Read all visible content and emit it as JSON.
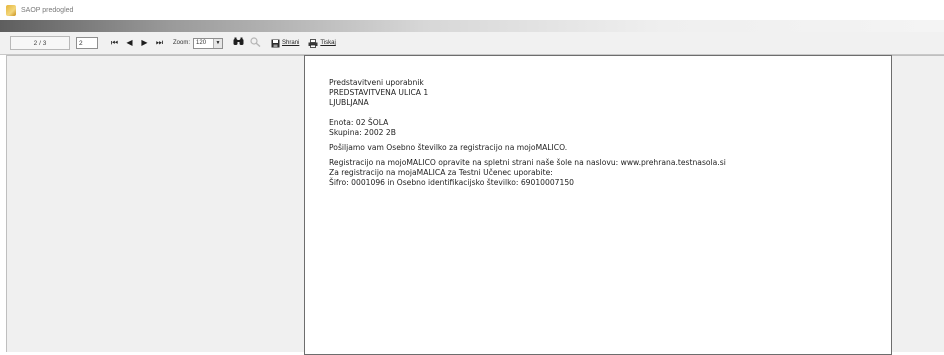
{
  "window": {
    "title": "SAOP predogled"
  },
  "toolbar": {
    "page_count": "2 / 3",
    "page_input": "2",
    "nav": {
      "first": "⏮",
      "prev": "◀",
      "next": "▶",
      "last": "⏭"
    },
    "zoom_label": "Zoom:",
    "zoom_value": "120",
    "find_glyph": "🔍",
    "save_label": "Shrani",
    "print_label": "Tiskaj"
  },
  "document": {
    "recipient_name": "Predstavitveni uporabnik",
    "street": "PREDSTAVITVENA ULICA 1",
    "city": "LJUBLJANA",
    "unit": "Enota: 02 ŠOLA",
    "group": "Skupina: 2002 2B",
    "intro": "Pošiljamo vam Osebno številko za registracijo na mojoMALICO.",
    "registration_info": "Registracijo na mojoMALICO opravite na spletni strani naše šole na naslovu: www.prehrana.testnasola.si",
    "registration_for": "Za registracijo na mojaMALICA za Testni Učenec uporabite:",
    "credentials": "Šifro: 0001096 in Osebno identifikacijsko številko: 69010007150"
  },
  "icons": {
    "app": "app-icon",
    "find": "binoculars-icon",
    "find_next": "find-next-icon",
    "save": "floppy-disk-icon",
    "print": "printer-icon"
  }
}
